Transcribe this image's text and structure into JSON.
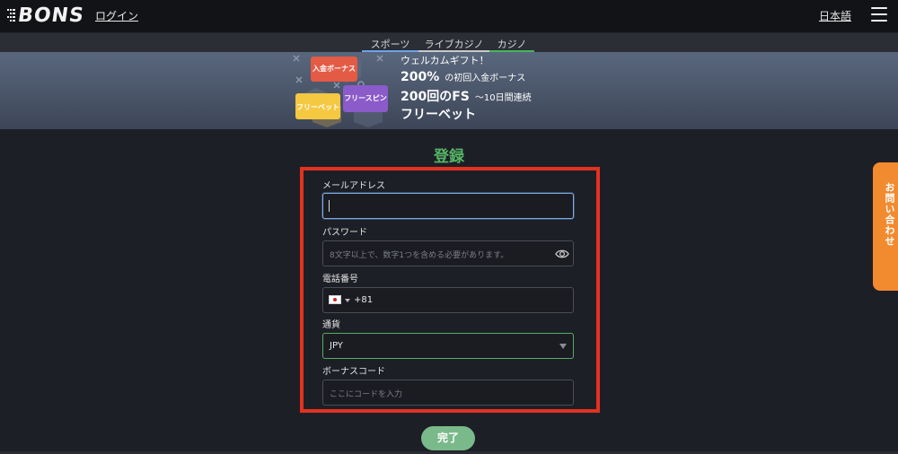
{
  "header": {
    "logo": "BONS",
    "login_label": "ログイン",
    "language_label": "日本語",
    "menu_icon": "hamburger-icon"
  },
  "tabs": [
    {
      "label": "スポーツ",
      "color": "#6ea3e8"
    },
    {
      "label": "ライブカジノ",
      "color": "#c9c9c9"
    },
    {
      "label": "カジノ",
      "color": "#49b45a"
    }
  ],
  "banner": {
    "badges": {
      "deposit_bonus": "入金ボーナス",
      "free_bet": "フリーベット",
      "free_spin": "フリースピン"
    },
    "welcome": "ウェルカムギフト！",
    "line1_big": "200%",
    "line1_small": "の初回入金ボーナス",
    "line2_big": "200回のFS",
    "line2_small": "〜10日間連続",
    "line3": "フリーベット"
  },
  "form": {
    "title": "登録",
    "email_label": "メールアドレス",
    "email_value": "",
    "password_label": "パスワード",
    "password_placeholder": "8文字以上で、数字1つを含める必要があります。",
    "phone_label": "電話番号",
    "phone_dial_code": "+81",
    "currency_label": "通貨",
    "currency_value": "JPY",
    "bonus_label": "ボーナスコード",
    "bonus_placeholder": "ここにコードを入力",
    "submit_label": "完了"
  },
  "side": {
    "contact_label": "お問い合わせ"
  },
  "colors": {
    "accent_green": "#55b565",
    "highlight_red": "#e33221",
    "contact_orange": "#f28a30",
    "submit_green": "#79b98a"
  }
}
